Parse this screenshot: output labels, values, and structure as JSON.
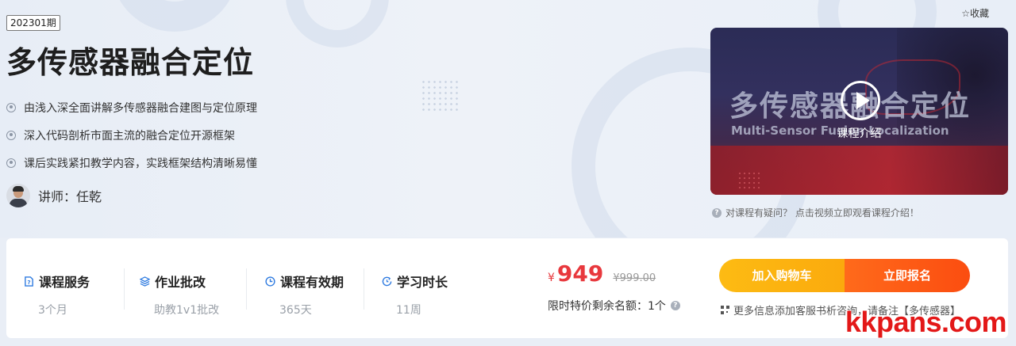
{
  "header": {
    "favorite_label": "☆收藏"
  },
  "course": {
    "period": "202301期",
    "title": "多传感器融合定位",
    "features": [
      "由浅入深全面讲解多传感器融合建图与定位原理",
      "深入代码剖析市面主流的融合定位开源框架",
      "课后实践紧扣教学内容，实践框架结构清晰易懂"
    ],
    "teacher": "讲师：任乾"
  },
  "video": {
    "cover_title": "多传感器融合定位",
    "cover_subtitle": "Multi-Sensor Fusion Localization",
    "play_label": "课程介绍",
    "hint": "对课程有疑问？ 点击视频立即观看课程介绍！"
  },
  "services": [
    {
      "title": "课程服务",
      "value": "3个月",
      "icon": "document-question-icon"
    },
    {
      "title": "作业批改",
      "value": "助教1v1批改",
      "icon": "layers-icon"
    },
    {
      "title": "课程有效期",
      "value": "365天",
      "icon": "clock-icon"
    },
    {
      "title": "学习时长",
      "value": "11周",
      "icon": "refresh-clock-icon"
    }
  ],
  "pricing": {
    "currency": "¥",
    "price": "949",
    "original_price": "¥999.00",
    "quota_text": "限时特价剩余名额：1个"
  },
  "actions": {
    "cart_label": "加入购物车",
    "enroll_label": "立即报名",
    "consult_text": "更多信息添加客服书析咨询，请备注【多传感器】"
  },
  "watermark": "kkpans.com",
  "colors": {
    "accent_red": "#e8383d",
    "service_icon_blue": "#2f7be0",
    "cart_yellow": "#fdbb13",
    "enroll_orange": "#ff5a16"
  }
}
